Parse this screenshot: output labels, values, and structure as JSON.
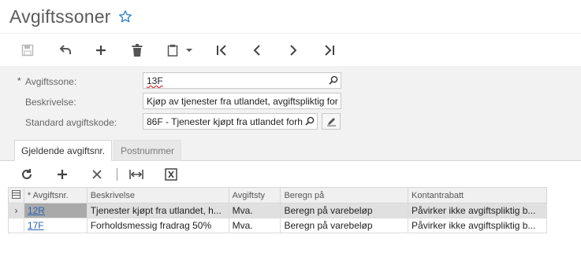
{
  "page": {
    "title": "Avgiftssoner"
  },
  "colors": {
    "accent": "#2a7fd0",
    "link": "#2a64b0",
    "form_bg": "#f2f2f2"
  },
  "toolbar": {
    "buttons": [
      "save-icon",
      "undo-icon",
      "add-icon",
      "delete-icon",
      "clipboard-icon",
      "first-icon",
      "previous-icon",
      "next-icon",
      "last-icon"
    ]
  },
  "form": {
    "required_mark": "*",
    "zone": {
      "label": "Avgiftssone:",
      "value": "13F"
    },
    "description": {
      "label": "Beskrivelse:",
      "value": "Kjøp av tjenester fra utlandet, avgiftspliktig for"
    },
    "default_code": {
      "label": "Standard avgiftskode:",
      "value": "86F - Tjenester kjøpt fra utlandet forh"
    }
  },
  "tabs": [
    {
      "label": "Gjeldende avgiftsnr.",
      "active": true
    },
    {
      "label": "Postnummer",
      "active": false
    }
  ],
  "grid_toolbar": [
    "refresh-icon",
    "add-icon",
    "delete-icon",
    "fit-columns-icon",
    "export-excel-icon"
  ],
  "grid": {
    "required_mark": "*",
    "columns": [
      "Avgiftsnr.",
      "Beskrivelse",
      "Avgiftsty",
      "Beregn på",
      "Kontantrabatt"
    ],
    "rows": [
      {
        "indicator": "›",
        "code": "12R",
        "description": "Tjenester kjøpt fra utlandet, h...",
        "type": "Mva.",
        "calc": "Beregn på varebeløp",
        "discount": "Påvirker ikke avgiftspliktig b..."
      },
      {
        "indicator": "",
        "code": "17F",
        "description": "Forholdsmessig fradrag 50%",
        "type": "Mva.",
        "calc": "Beregn på varebeløp",
        "discount": "Påvirker ikke avgiftspliktig b..."
      }
    ]
  }
}
